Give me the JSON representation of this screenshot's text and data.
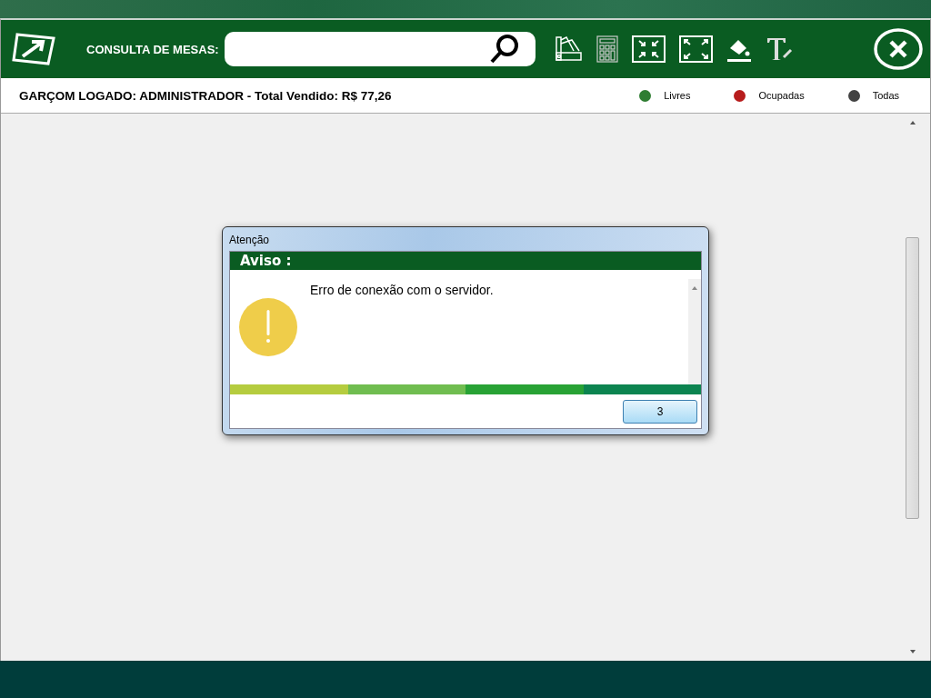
{
  "header": {
    "search_label": "CONSULTA DE MESAS:"
  },
  "status_bar": {
    "text": "GARÇOM LOGADO: ADMINISTRADOR - Total Vendido: R$ 77,26",
    "legend": [
      {
        "label": "Livres",
        "color": "#2e7d32"
      },
      {
        "label": "Ocupadas",
        "color": "#b71c1c"
      },
      {
        "label": "Todas",
        "color": "#424242"
      }
    ]
  },
  "dialog": {
    "title": "Atenção",
    "heading": "Aviso :",
    "message": "Erro de conexão com o servidor.",
    "button": "3"
  }
}
